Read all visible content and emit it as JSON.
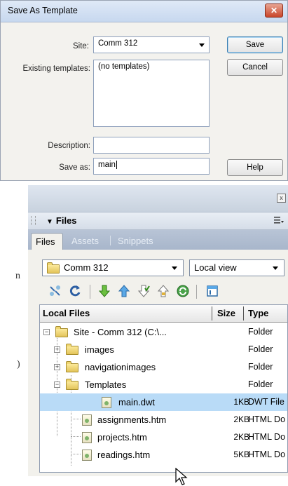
{
  "dialog": {
    "title": "Save As Template",
    "close_glyph": "✕",
    "site_label": "Site:",
    "site_value": "Comm 312",
    "existing_label": "Existing templates:",
    "existing_value": "(no templates)",
    "description_label": "Description:",
    "description_value": "",
    "save_as_label": "Save as:",
    "save_as_value": "main",
    "save_button": "Save",
    "cancel_button": "Cancel",
    "help_button": "Help"
  },
  "margin_fragments": [
    "n",
    ")"
  ],
  "files_panel": {
    "close_glyph": "x",
    "title": "Files",
    "tabs": [
      {
        "label": "Files",
        "active": true
      },
      {
        "label": "Assets",
        "active": false
      },
      {
        "label": "Snippets",
        "active": false
      }
    ],
    "site_select": "Comm 312",
    "view_select": "Local view",
    "toolbar_icons": [
      "connect-icon",
      "refresh-icon",
      "get-files-icon",
      "put-files-icon",
      "check-out-icon",
      "check-in-icon",
      "synchronize-icon",
      "expand-icon"
    ],
    "columns": {
      "name": "Local Files",
      "size": "Size",
      "type": "Type"
    },
    "rows": [
      {
        "name": "Site - Comm 312 (C:\\...",
        "size": "",
        "type": "Folder",
        "kind": "folder",
        "expander": "−"
      },
      {
        "name": "images",
        "size": "",
        "type": "Folder",
        "kind": "folder",
        "expander": "+"
      },
      {
        "name": "navigationimages",
        "size": "",
        "type": "Folder",
        "kind": "folder",
        "expander": "+"
      },
      {
        "name": "Templates",
        "size": "",
        "type": "Folder",
        "kind": "folder",
        "expander": "−"
      },
      {
        "name": "main.dwt",
        "size": "1KB",
        "type": "DWT File",
        "kind": "file",
        "selected": true
      },
      {
        "name": "assignments.htm",
        "size": "2KB",
        "type": "HTML Do",
        "kind": "file"
      },
      {
        "name": "projects.htm",
        "size": "2KB",
        "type": "HTML Do",
        "kind": "file"
      },
      {
        "name": "readings.htm",
        "size": "5KB",
        "type": "HTML Do",
        "kind": "file"
      }
    ]
  },
  "colors": {
    "selection": "#b9dbf7",
    "accent": "#3c7fb1"
  }
}
